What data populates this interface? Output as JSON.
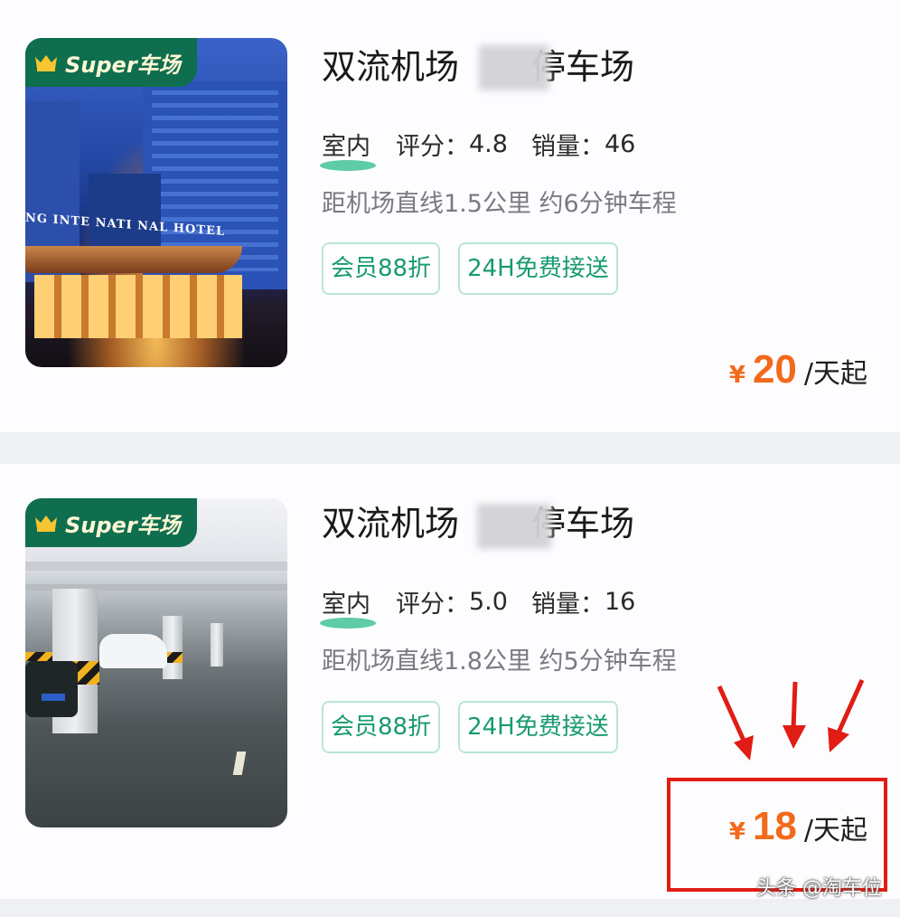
{
  "listings": [
    {
      "badge": {
        "brand": "Super车场",
        "icon": "crown-icon"
      },
      "image": "hotel-exterior-photo",
      "title": {
        "before": "双流机场",
        "after": "停车场"
      },
      "type": "室内",
      "rating_label": "评分：",
      "rating": "4.8",
      "sales_label": "销量：",
      "sales": "46",
      "distance": "距机场直线1.5公里 约6分钟车程",
      "tags": [
        "会员88折",
        "24H免费接送"
      ],
      "price": {
        "currency": "¥",
        "amount": "20",
        "unit": "/天起"
      },
      "hotel_sign": "NG INTE NATI  NAL HOTEL"
    },
    {
      "badge": {
        "brand": "Super车场",
        "icon": "crown-icon"
      },
      "image": "underground-garage-photo",
      "title": {
        "before": "双流机场",
        "after": "停车场"
      },
      "type": "室内",
      "rating_label": "评分：",
      "rating": "5.0",
      "sales_label": "销量：",
      "sales": "16",
      "distance": "距机场直线1.8公里 约5分钟车程",
      "tags": [
        "会员88折",
        "24H免费接送"
      ],
      "price": {
        "currency": "¥",
        "amount": "18",
        "unit": "/天起"
      }
    }
  ],
  "annotation": {
    "box_color": "#e11c14",
    "arrow_color": "#e11c14",
    "arrows": 3
  },
  "colors": {
    "accent_green": "#179a72",
    "price_orange": "#f26a1b",
    "badge_green": "#0e6e4e"
  },
  "watermark": "头条 @淘车位"
}
